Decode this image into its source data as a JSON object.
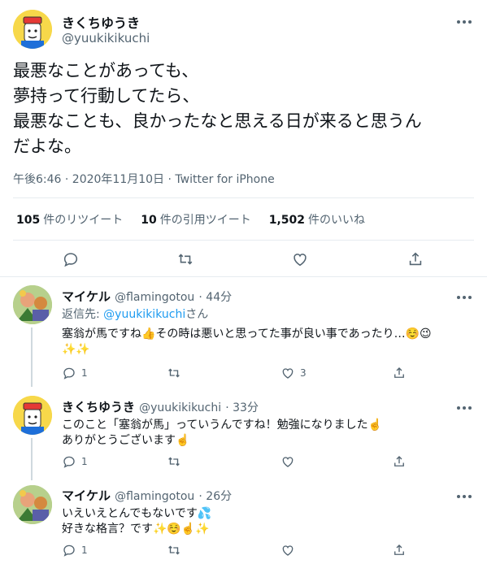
{
  "tweet": {
    "author_name": "きくちゆうき",
    "author_handle": "@yuukikikuchi",
    "lines": [
      "最悪なことがあっても、",
      "夢持って行動してたら、",
      "最悪なことも、良かったなと思える日が来ると思うん",
      "だよな。"
    ],
    "meta": "午後6:46 · 2020年11月10日 · Twitter for iPhone",
    "stats": [
      {
        "count": "105",
        "label": "件のリツイート"
      },
      {
        "count": "10",
        "label": "件の引用ツイート"
      },
      {
        "count": "1,502",
        "label": "件のいいね"
      }
    ]
  },
  "replies": [
    {
      "name": "マイケル",
      "handle": "@flamingotou",
      "time": "· 44分",
      "reply_to_prefix": "返信先: ",
      "reply_to_handle": "@yuukikikuchi",
      "reply_to_suffix": "さん",
      "line1": "塞翁が馬ですね👍その時は悪いと思ってた事が良い事であったり…☺️😉",
      "line2": "✨✨",
      "reply_count": "1",
      "like_count": "3"
    },
    {
      "name": "きくちゆうき",
      "handle": "@yuukikikuchi",
      "time": "· 33分",
      "line1": "このこと「塞翁が馬」っていうんですね！勉強になりました☝️",
      "line2": "ありがとうございます☝️",
      "reply_count": "1"
    },
    {
      "name": "マイケル",
      "handle": "@flamingotou",
      "time": "· 26分",
      "line1": "いえいえとんでもないです💦",
      "line2": "好きな格言？です✨☺️☝️✨",
      "reply_count": "1"
    }
  ],
  "colors": {
    "accent": "#1d9bf0",
    "secondary_text": "#536471",
    "divider": "#e6ecf0"
  },
  "icons": [
    "reply-icon",
    "retweet-icon",
    "like-icon",
    "share-icon",
    "more-icon"
  ]
}
